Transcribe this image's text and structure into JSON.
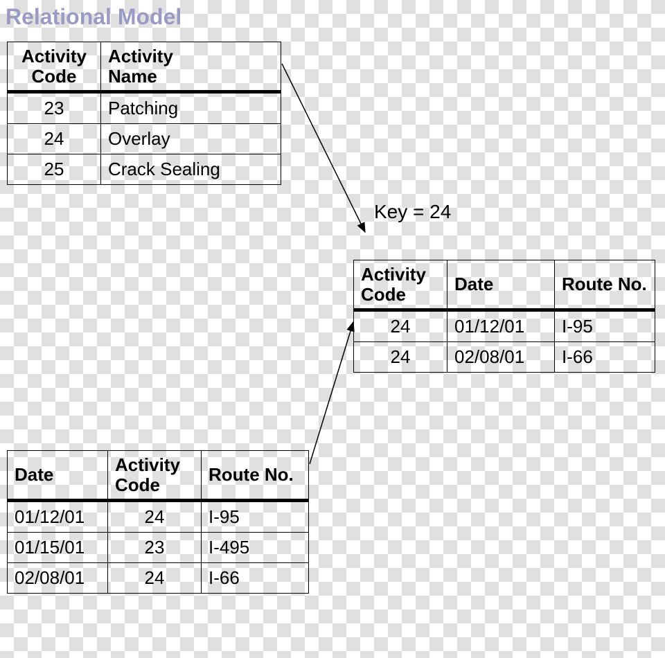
{
  "title": "Relational Model",
  "key_label": "Key = 24",
  "activity_table": {
    "headers": {
      "code": "Activity\nCode",
      "name": "Activity\nName"
    },
    "rows": [
      {
        "code": "23",
        "name": "Patching"
      },
      {
        "code": "24",
        "name": "Overlay"
      },
      {
        "code": "25",
        "name": "Crack Sealing"
      }
    ]
  },
  "work_table": {
    "headers": {
      "date": "Date",
      "code": "Activity\nCode",
      "route": "Route No."
    },
    "rows": [
      {
        "date": "01/12/01",
        "code": "24",
        "route": "I-95"
      },
      {
        "date": "01/15/01",
        "code": "23",
        "route": "I-495"
      },
      {
        "date": "02/08/01",
        "code": "24",
        "route": "I-66"
      }
    ]
  },
  "result_table": {
    "headers": {
      "code": "Activity\nCode",
      "date": "Date",
      "route": "Route No."
    },
    "rows": [
      {
        "code": "24",
        "date": "01/12/01",
        "route": "I-95"
      },
      {
        "code": "24",
        "date": "02/08/01",
        "route": "I-66"
      }
    ]
  }
}
